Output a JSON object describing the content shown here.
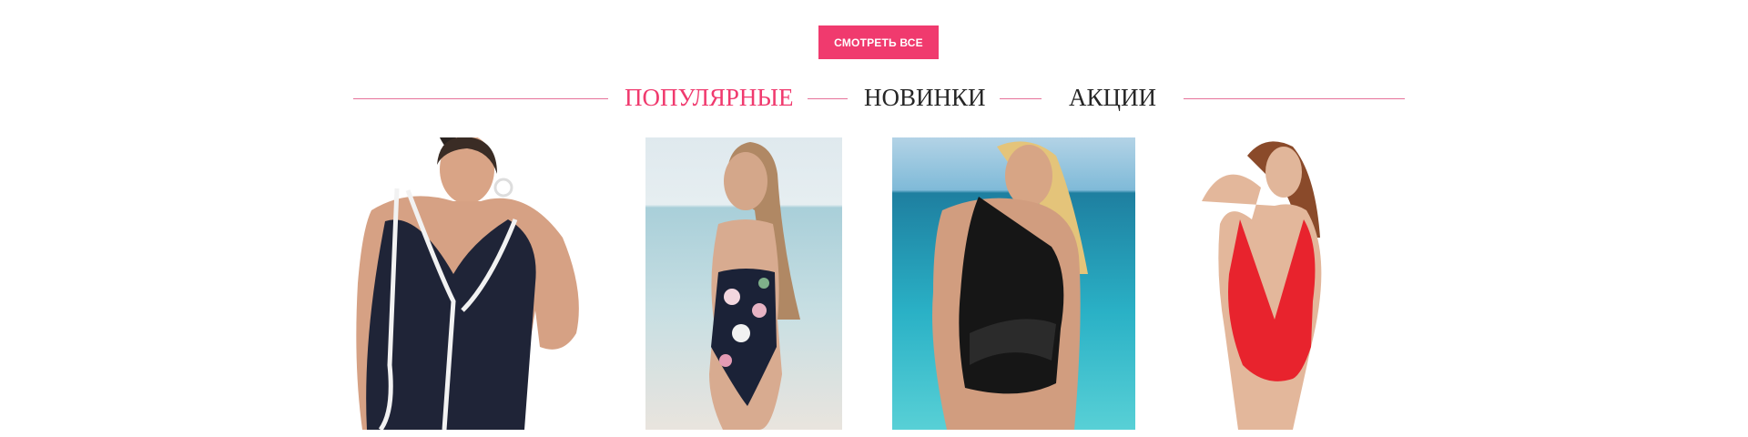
{
  "view_all": {
    "label": "СМОТРЕТЬ ВСЕ"
  },
  "tabs": [
    {
      "label": "ПОПУЛЯРНЫЕ",
      "active": true
    },
    {
      "label": "НОВИНКИ",
      "active": false
    },
    {
      "label": "АКЦИИ",
      "active": false
    }
  ],
  "colors": {
    "accent": "#f03a6e",
    "line": "#e6739a",
    "text": "#262626"
  },
  "products": [
    {
      "name": "product-image-navy-v-neck-swimsuit"
    },
    {
      "name": "product-image-floral-bandeau-swimsuit"
    },
    {
      "name": "product-image-black-one-shoulder-swimsuit"
    },
    {
      "name": "product-image-red-halter-swimsuit"
    }
  ]
}
